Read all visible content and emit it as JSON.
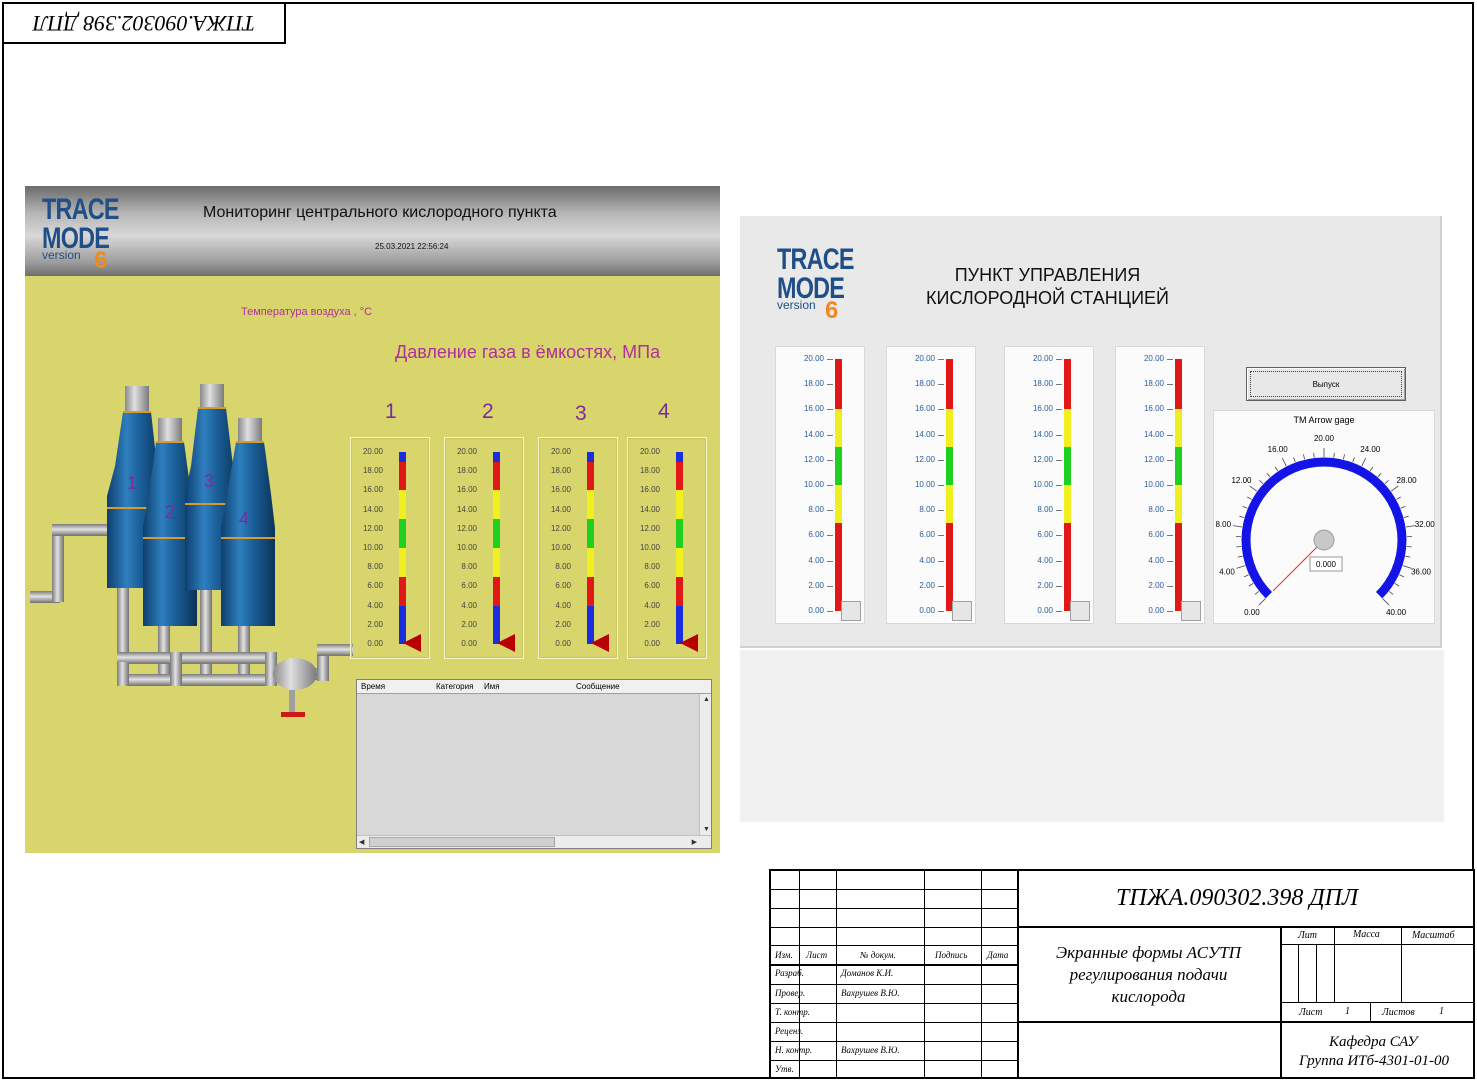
{
  "stamp": {
    "code": "ТПЖА.090302.398 ДПЛ"
  },
  "screen1": {
    "logo": {
      "line1": "TRACE",
      "line2": "MODE",
      "version": "version",
      "num": "6"
    },
    "title": "Мониторинг центрального кислородного пункта",
    "datetime": "25.03.2021 22:56:24",
    "temp_label": "Температура воздуха , °С",
    "pressure_label": "Давление газа в ёмкостях, МПа",
    "tank_labels": [
      "1",
      "2",
      "3",
      "4"
    ],
    "gauge_numbers": [
      "1",
      "2",
      "3",
      "4"
    ],
    "gauge_ticks": [
      "20.00",
      "18.00",
      "16.00",
      "14.00",
      "12.00",
      "10.00",
      "8.00",
      "6.00",
      "4.00",
      "2.00",
      "0.00"
    ],
    "events_table": {
      "columns": [
        "Время",
        "Категория",
        "Имя",
        "Сообщение"
      ],
      "rows": []
    }
  },
  "screen2": {
    "logo": {
      "line1": "TRACE",
      "line2": "MODE",
      "version": "version",
      "num": "6"
    },
    "title_line1": "ПУНКТ УПРАВЛЕНИЯ",
    "title_line2": "КИСЛОРОДНОЙ СТАНЦИЕЙ",
    "gauge_ticks": [
      "20.00",
      "18.00",
      "16.00",
      "14.00",
      "12.00",
      "10.00",
      "8.00",
      "6.00",
      "4.00",
      "2.00",
      "0.00"
    ],
    "release_button": "Выпуск",
    "arrow_gage": {
      "title": "TM Arrow gage",
      "ticks": [
        "0.00",
        "4.00",
        "8.00",
        "12.00",
        "16.00",
        "20.00",
        "24.00",
        "28.00",
        "32.00",
        "36.00",
        "40.00"
      ],
      "value": "0.000",
      "min": 0,
      "max": 40,
      "needle_value": 0,
      "arc_color": "#1414e6"
    }
  },
  "title_block": {
    "doc_code": "ТПЖА.090302.398 ДПЛ",
    "doc_title_lines": [
      "Экранные формы АСУТП",
      "регулирования подачи",
      "кислорода"
    ],
    "col_headers": {
      "izm": "Изм.",
      "list": "Лист",
      "n_dokum": "№ докум.",
      "podpis": "Подпись",
      "data": "Дата"
    },
    "roles": [
      {
        "role": "Разраб.",
        "name": "Доманов К.И."
      },
      {
        "role": "Провер.",
        "name": "Вахрушев В.Ю."
      },
      {
        "role": "Т. контр.",
        "name": ""
      },
      {
        "role": "Реценз.",
        "name": ""
      },
      {
        "role": "Н. контр.",
        "name": "Вахрушев В.Ю."
      },
      {
        "role": "Утв.",
        "name": ""
      }
    ],
    "lit": "Лит",
    "massa": "Масса",
    "masshtab": "Масштаб",
    "list_label": "Лист",
    "list_value": "1",
    "listov_label": "Листов",
    "listov_value": "1",
    "dept": "Кафедра САУ",
    "group": "Группа ИТб-4301-01-00"
  }
}
